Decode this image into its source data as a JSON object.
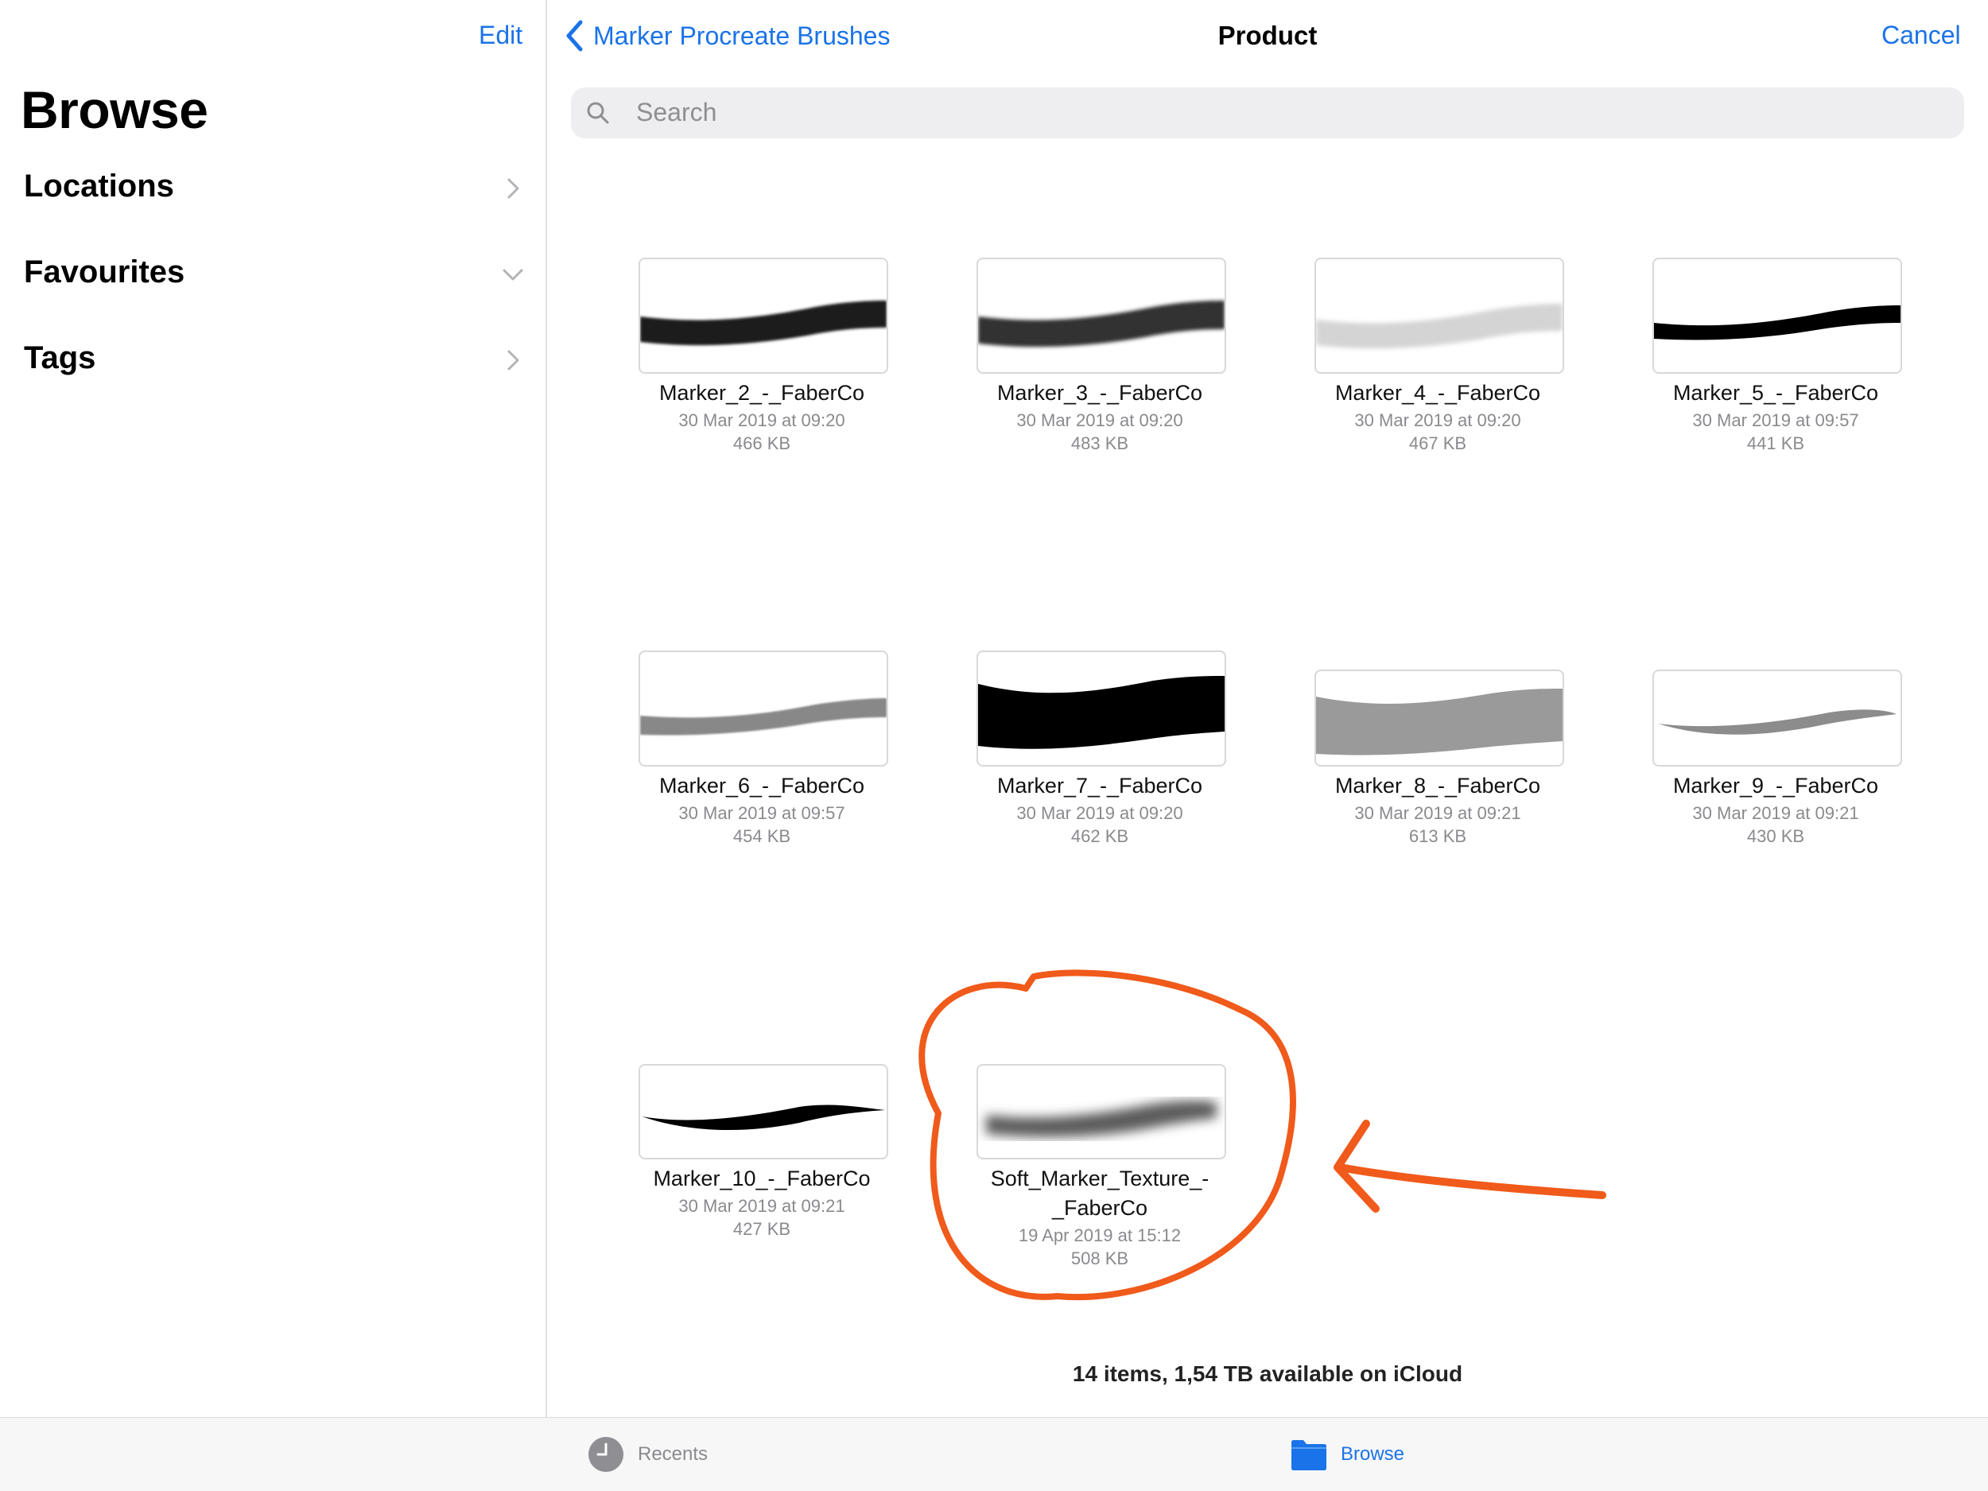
{
  "sidebar": {
    "edit_label": "Edit",
    "title": "Browse",
    "items": [
      {
        "label": "Locations",
        "icon": "chevron-right-icon"
      },
      {
        "label": "Favourites",
        "icon": "chevron-down-icon"
      },
      {
        "label": "Tags",
        "icon": "chevron-right-icon"
      }
    ]
  },
  "header": {
    "back_label": "Marker Procreate Brushes",
    "title": "Product",
    "cancel_label": "Cancel"
  },
  "search": {
    "placeholder": "Search"
  },
  "files": [
    {
      "name": "Marker_2_-_FaberCo",
      "date": "30 Mar 2019 at 09:20",
      "size": "466 KB"
    },
    {
      "name": "Marker_3_-_FaberCo",
      "date": "30 Mar 2019 at 09:20",
      "size": "483 KB"
    },
    {
      "name": "Marker_4_-_FaberCo",
      "date": "30 Mar 2019 at 09:20",
      "size": "467 KB"
    },
    {
      "name": "Marker_5_-_FaberCo",
      "date": "30 Mar 2019 at 09:57",
      "size": "441 KB"
    },
    {
      "name": "Marker_6_-_FaberCo",
      "date": "30 Mar 2019 at 09:57",
      "size": "454 KB"
    },
    {
      "name": "Marker_7_-_FaberCo",
      "date": "30 Mar 2019 at 09:20",
      "size": "462 KB"
    },
    {
      "name": "Marker_8_-_FaberCo",
      "date": "30 Mar 2019 at 09:21",
      "size": "613 KB"
    },
    {
      "name": "Marker_9_-_FaberCo",
      "date": "30 Mar 2019 at 09:21",
      "size": "430 KB"
    },
    {
      "name": "Marker_10_-_FaberCo",
      "date": "30 Mar 2019 at 09:21",
      "size": "427 KB"
    },
    {
      "name_line1": "Soft_Marker_Texture_-",
      "name_line2": "_FaberCo",
      "date": "19 Apr 2019 at 15:12",
      "size": "508 KB"
    }
  ],
  "footer_info": "14 items, 1,54 TB available on iCloud",
  "tabbar": {
    "recents_label": "Recents",
    "browse_label": "Browse"
  },
  "colors": {
    "accent": "#1a73e8",
    "annotation": "#f05a1a"
  }
}
